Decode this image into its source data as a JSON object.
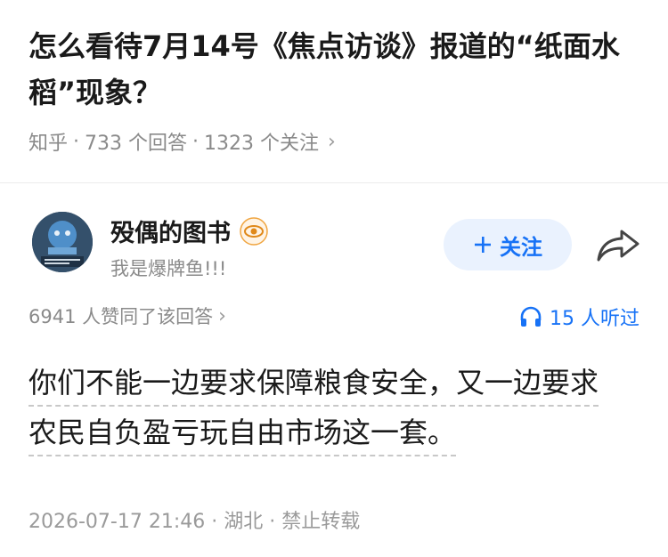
{
  "question": {
    "title": "怎么看待7月14号《焦点访谈》报道的“纸面水稻”现象？",
    "source": "知乎",
    "answers": "733 个回答",
    "followers": "1323 个关注"
  },
  "author": {
    "name": "殁偶的图书",
    "bio": "我是爆牌鱼!!!",
    "follow_label": "关注"
  },
  "answer": {
    "votes": "6941 人赞同了该回答",
    "listeners": "15 人听过",
    "lines": [
      "你们不能一边要求保障粮食安全，又一边要求",
      "农民自负盈亏玩自由市场这一套。"
    ],
    "footer": "2026-07-17 21:46 · 湖北 · 禁止转载"
  },
  "colors": {
    "accent": "#1772f6",
    "follow_bg": "#eaf2fe",
    "muted": "#8a8a8a"
  }
}
